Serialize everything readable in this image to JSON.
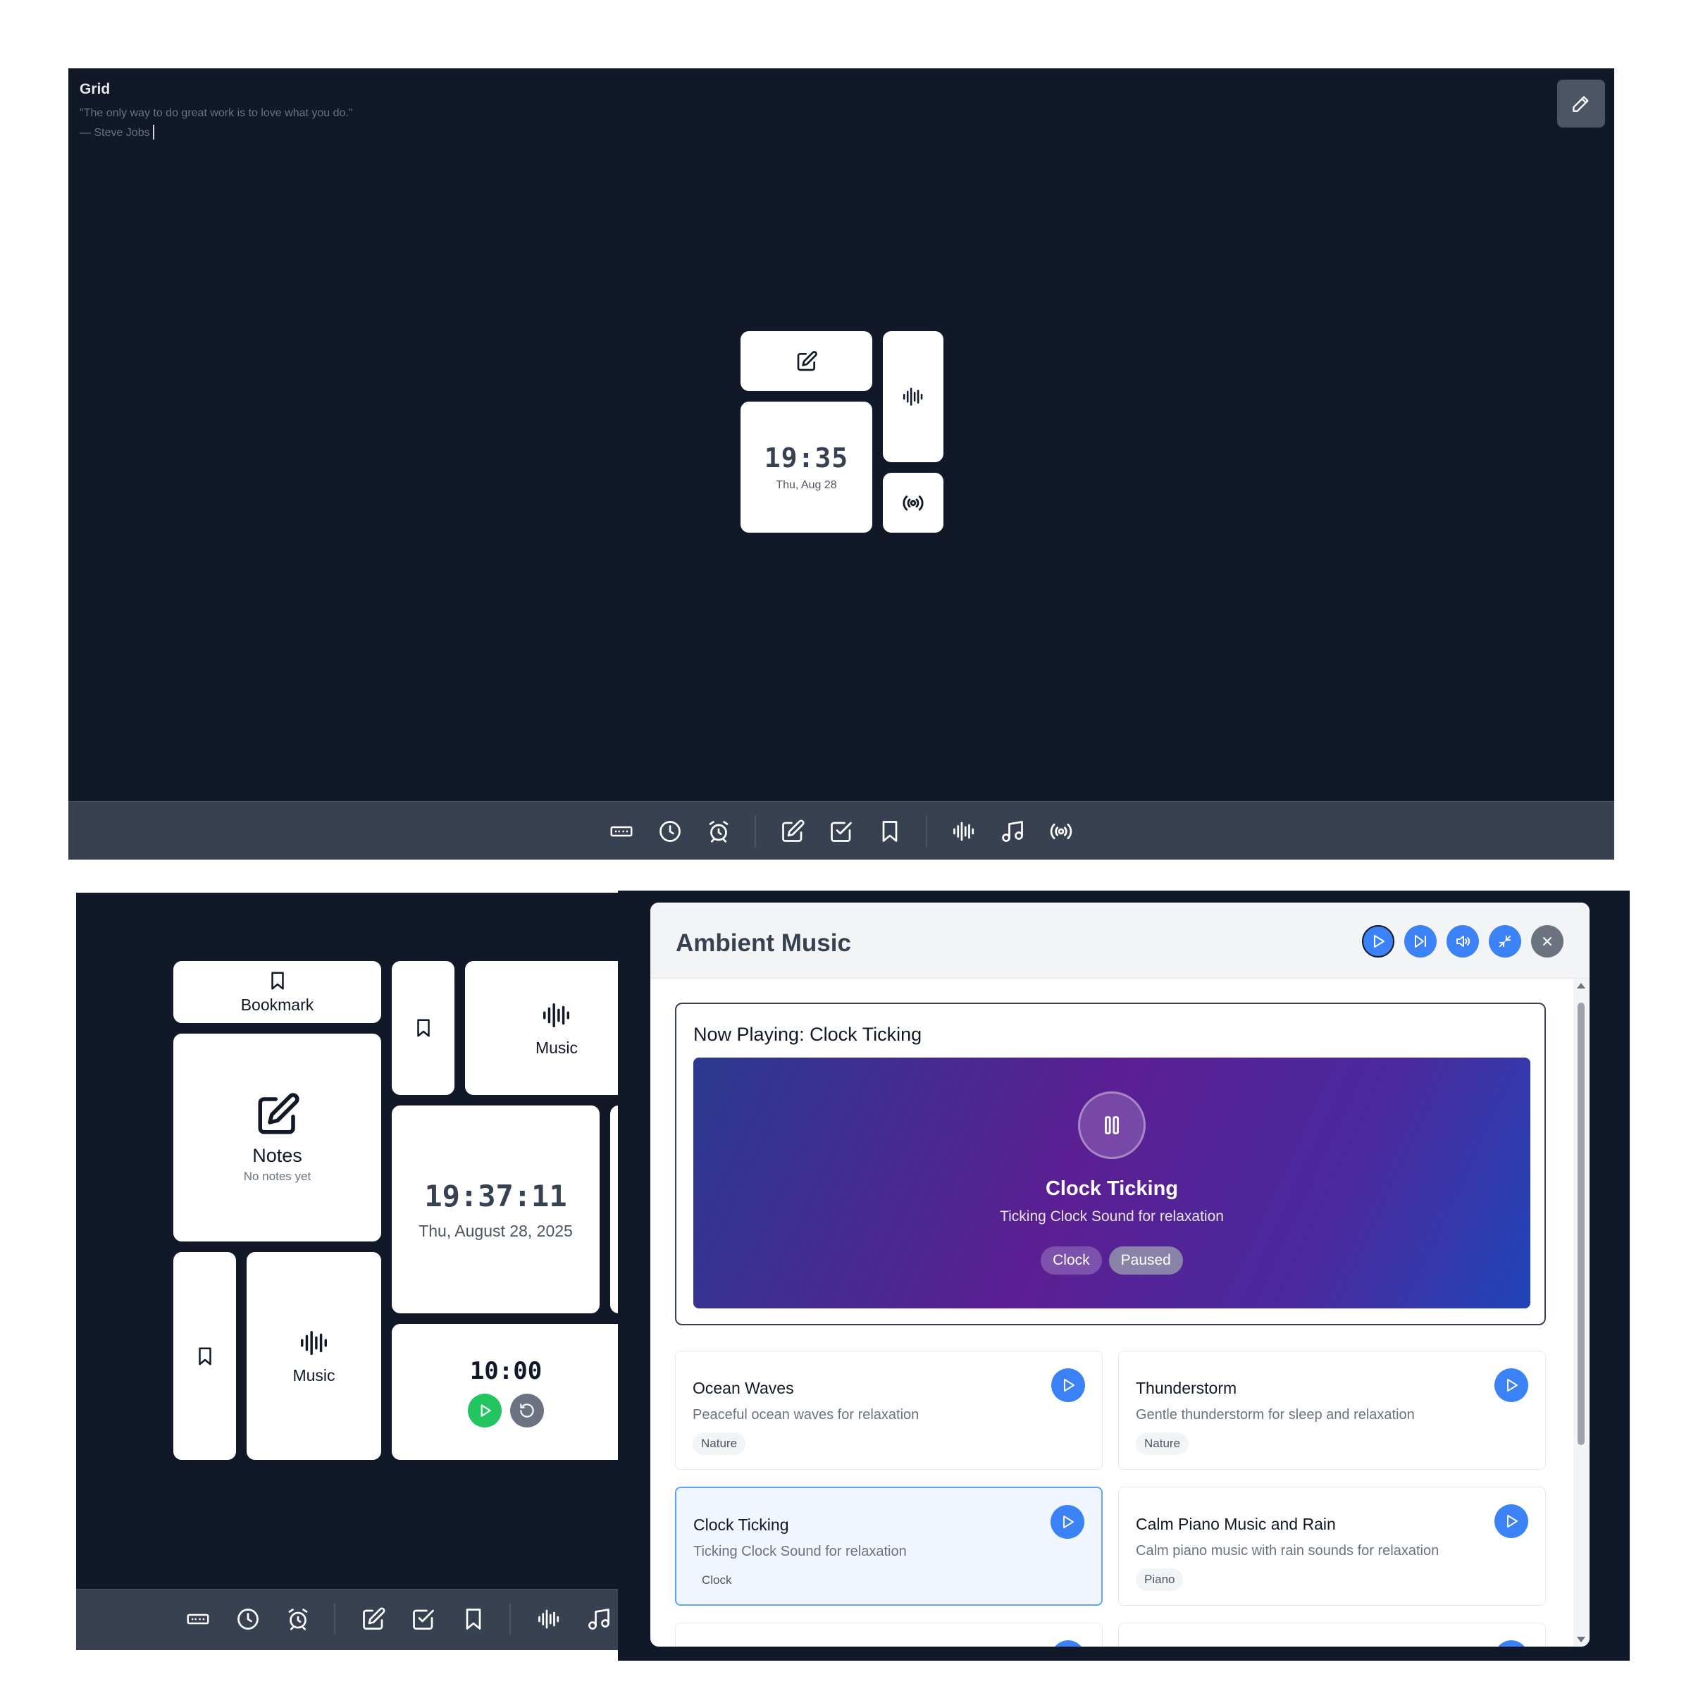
{
  "top_window": {
    "title": "Grid",
    "quote": "\"The only way to do great work is to love what you do.\"",
    "author": "— Steve Jobs",
    "clock": {
      "time": "19:35",
      "date": "Thu, Aug 28"
    }
  },
  "bottom_left_window": {
    "bookmark_label": "Bookmark",
    "music_label": "Music",
    "notes_title": "Notes",
    "notes_empty": "No notes yet",
    "clock": {
      "time": "19:37:11",
      "date": "Thu, August 28, 2025"
    },
    "timer": "10:00",
    "music_label_2": "Music"
  },
  "ambient_music": {
    "title": "Ambient Music",
    "now_playing_title": "Now Playing: Clock Ticking",
    "now_playing": {
      "name": "Clock Ticking",
      "description": "Ticking Clock Sound for relaxation",
      "category": "Clock",
      "status": "Paused"
    },
    "tracks": [
      {
        "name": "Ocean Waves",
        "description": "Peaceful ocean waves for relaxation",
        "tag": "Nature",
        "active": false
      },
      {
        "name": "Thunderstorm",
        "description": "Gentle thunderstorm for sleep and relaxation",
        "tag": "Nature",
        "active": false
      },
      {
        "name": "Clock Ticking",
        "description": "Ticking Clock Sound for relaxation",
        "tag": "Clock",
        "active": true
      },
      {
        "name": "Calm Piano Music and Rain",
        "description": "Calm piano music with rain sounds for relaxation",
        "tag": "Piano",
        "active": false
      }
    ]
  },
  "colors": {
    "bg_dark": "#111827",
    "toolbar": "#374151",
    "accent_blue": "#3b82f6",
    "play_green": "#22c55e",
    "reset_gray": "#6b7280"
  },
  "icons": {
    "toolbar": [
      "keyboard-icon",
      "clock-icon",
      "alarm-icon",
      "note-edit-icon",
      "checkbox-icon",
      "bookmark-icon",
      "waveform-icon",
      "music-note-icon",
      "radio-icon"
    ]
  }
}
